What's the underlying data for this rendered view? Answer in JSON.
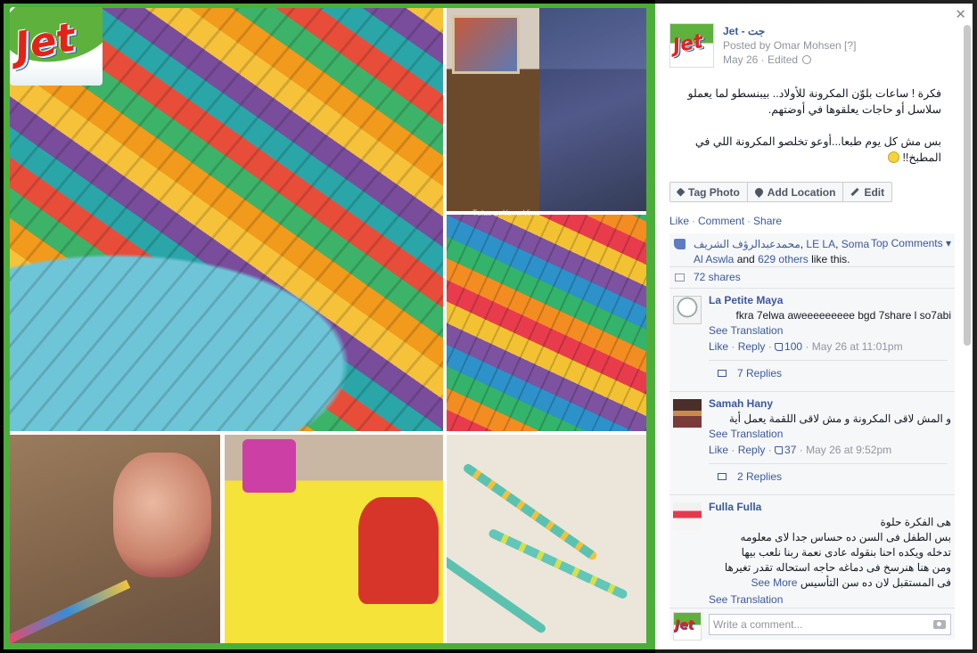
{
  "logo_text": "Jet",
  "page": {
    "name": "Jet - جت",
    "posted_by": "Posted by Omar Mohsen [?]",
    "date": "May 26 · Edited"
  },
  "post": {
    "paragraph1": "فكرة ! ساعات بلوّن المكرونة للأولاد.. بيبنسطو لما يعملو سلاسل أو حاجات يعلقوها في أوضتهم.",
    "paragraph2": "بس مش كل يوم طبعا...أوعو تخلصو المكرونة اللي في المطبخ!!"
  },
  "buttons": {
    "tag_photo": "Tag Photo",
    "add_location": "Add Location",
    "edit": "Edit"
  },
  "actions": {
    "like": "Like",
    "comment": "Comment",
    "share": "Share"
  },
  "likes": {
    "name1": "محمدعبدالرؤف الشريف",
    "name2": "LE LA",
    "name3": "Soma Al Aswla",
    "and": "and",
    "others": "629 others",
    "suffix": "like this.",
    "top_comments": "Top Comments ▾"
  },
  "shares": "72 shares",
  "comments": [
    {
      "name": "La Petite Maya",
      "text": "fkra 7elwa aweeeeeeeee bgd 7share l so7abi",
      "see_translation": "See Translation",
      "like": "Like",
      "reply": "Reply",
      "likes": "100",
      "time": "May 26 at 11:01pm",
      "replies": "7 Replies"
    },
    {
      "name": "Samah Hany",
      "text": "و المش لاقى المكرونة و مش لاقى اللقمة يعمل أية",
      "see_translation": "See Translation",
      "like": "Like",
      "reply": "Reply",
      "likes": "37",
      "time": "May 26 at 9:52pm",
      "replies": "2 Replies"
    },
    {
      "name": "Fulla Fulla",
      "lines": [
        "هى الفكرة حلوة",
        "بس الطفل فى السن ده حساس جدا لاى معلومه",
        "تدخله ويكده احنا بنقوله عادى نعمة ربنا نلعب بيها",
        "ومن هنا هنرسخ فى دماغه حاجه استحاله تقدر تغيرها",
        "فى المستقبل لان ده سن التأسيس"
      ],
      "see_more": "See More",
      "see_translation": "See Translation"
    }
  ],
  "composer": {
    "placeholder": "Write a comment..."
  },
  "photo_caption": "Tulas ... Yo ... Vi ..."
}
